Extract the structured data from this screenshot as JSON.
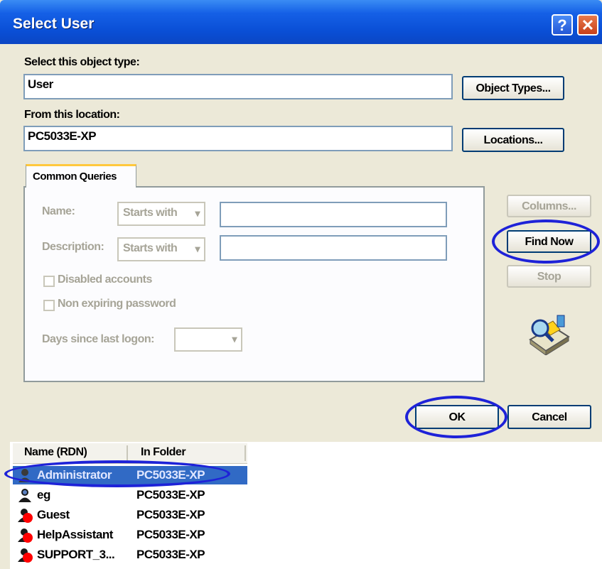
{
  "window": {
    "title": "Select User"
  },
  "title_buttons": {
    "help": "?",
    "close": "✕"
  },
  "object_type": {
    "label": "Select this object type:",
    "value": "User",
    "button": "Object Types..."
  },
  "location": {
    "label": "From this location:",
    "value": "PC5033E-XP",
    "button": "Locations..."
  },
  "tab": {
    "label": "Common Queries"
  },
  "query": {
    "name_label": "Name:",
    "name_mode": "Starts with",
    "description_label": "Description:",
    "description_mode": "Starts with",
    "disabled_accounts": "Disabled accounts",
    "non_expiring_password": "Non expiring password",
    "days_since_logon": "Days since last logon:"
  },
  "side_buttons": {
    "columns": "Columns...",
    "find_now": "Find Now",
    "stop": "Stop"
  },
  "dialog_buttons": {
    "ok": "OK",
    "cancel": "Cancel"
  },
  "results": {
    "columns": [
      "Name (RDN)",
      "In Folder"
    ],
    "rows": [
      {
        "name": "Administrator",
        "folder": "PC5033E-XP",
        "selected": true,
        "disabled": false
      },
      {
        "name": "eg",
        "folder": "PC5033E-XP",
        "selected": false,
        "disabled": false
      },
      {
        "name": "Guest",
        "folder": "PC5033E-XP",
        "selected": false,
        "disabled": true
      },
      {
        "name": "HelpAssistant",
        "folder": "PC5033E-XP",
        "selected": false,
        "disabled": true
      },
      {
        "name": "SUPPORT_3...",
        "folder": "PC5033E-XP",
        "selected": false,
        "disabled": true
      }
    ]
  },
  "colors": {
    "title_bar": "#0b4fd6",
    "highlight_ellipse": "#1e22d8",
    "selection": "#316ac5",
    "disabled_badge": "#ff0000"
  }
}
